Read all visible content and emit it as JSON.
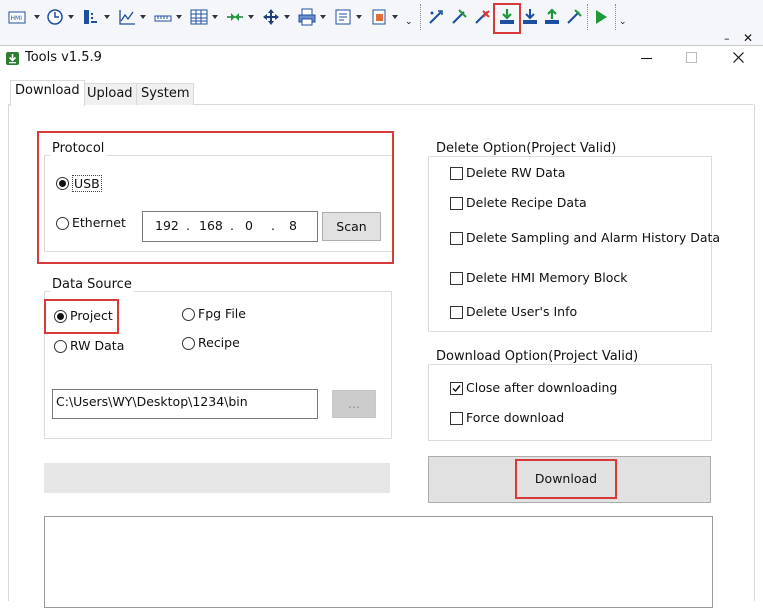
{
  "toolbar": {
    "buttons": [
      {
        "icon": "hmi-icon",
        "has_dropdown": true
      },
      {
        "icon": "clock-icon",
        "has_dropdown": true
      },
      {
        "icon": "bar-meter-icon",
        "has_dropdown": true
      },
      {
        "icon": "trend-chart-icon",
        "has_dropdown": true
      },
      {
        "icon": "ruler-icon",
        "has_dropdown": true
      },
      {
        "icon": "table-icon",
        "has_dropdown": true
      },
      {
        "icon": "valve-icon",
        "has_dropdown": true
      },
      {
        "icon": "move-icon",
        "has_dropdown": true
      },
      {
        "icon": "printer-icon",
        "has_dropdown": true
      },
      {
        "icon": "report-icon",
        "has_dropdown": true
      },
      {
        "icon": "recipe-icon",
        "has_dropdown": true
      },
      {
        "icon": "compile-icon",
        "has_dropdown": false
      },
      {
        "icon": "offline-sim-icon",
        "has_dropdown": false
      },
      {
        "icon": "online-sim-icon",
        "has_dropdown": false
      },
      {
        "icon": "download-icon",
        "has_dropdown": false
      },
      {
        "icon": "download-alt-icon",
        "has_dropdown": false
      },
      {
        "icon": "upload-icon",
        "has_dropdown": false
      },
      {
        "icon": "build-icon",
        "has_dropdown": false
      },
      {
        "icon": "run-icon",
        "has_dropdown": false
      }
    ],
    "accent_colors": {
      "blue": "#1d5fc4",
      "green": "#1e9a3a",
      "red": "#d83a3a"
    }
  },
  "window": {
    "title": "Tools v1.5.9",
    "app_icon": "download-arrow-icon",
    "controls": [
      "minimize-icon",
      "maximize-icon",
      "close-icon"
    ]
  },
  "tabs": [
    {
      "label": "Download",
      "active": true
    },
    {
      "label": "Upload",
      "active": false
    },
    {
      "label": "System",
      "active": false
    }
  ],
  "protocol": {
    "legend": "Protocol",
    "usb_label": "USB",
    "ethernet_label": "Ethernet",
    "selected": "USB",
    "ip": [
      "192",
      "168",
      "0",
      "8"
    ],
    "scan_label": "Scan"
  },
  "data_source": {
    "legend": "Data Source",
    "options": [
      "Project",
      "Fpg File",
      "RW Data",
      "Recipe"
    ],
    "selected": "Project",
    "path": "C:\\Users\\WY\\Desktop\\1234\\bin",
    "browse_label": "..."
  },
  "delete_option": {
    "legend": "Delete Option(Project Valid)",
    "items": [
      {
        "label": "Delete RW Data",
        "checked": false
      },
      {
        "label": "Delete Recipe Data",
        "checked": false
      },
      {
        "label": "Delete Sampling and Alarm History Data",
        "checked": false
      },
      {
        "label": "Delete HMI Memory Block",
        "checked": false
      },
      {
        "label": "Delete User's Info",
        "checked": false
      }
    ]
  },
  "download_option": {
    "legend": "Download Option(Project Valid)",
    "items": [
      {
        "label": "Close after downloading",
        "checked": true
      },
      {
        "label": "Force download",
        "checked": false
      }
    ]
  },
  "download_button": {
    "label": "Download"
  },
  "progress": {
    "value": 0
  },
  "log": {
    "text": ""
  },
  "highlight_color": "#d83a3a"
}
